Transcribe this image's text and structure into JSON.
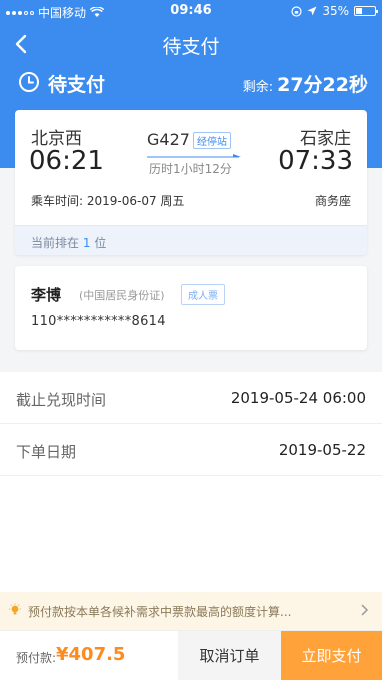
{
  "status_bar": {
    "carrier": "中国移动",
    "time": "09:46",
    "battery": "35%",
    "battery_level": 0.35
  },
  "nav": {
    "title": "待支付"
  },
  "order_status": {
    "label": "待支付",
    "remaining_label": "剩余:",
    "remaining_value": "27分22秒"
  },
  "trip": {
    "from_station": "北京西",
    "from_time": "06:21",
    "to_station": "石家庄",
    "to_time": "07:33",
    "train_no": "G427",
    "via_label": "经停站",
    "duration": "历时1小时12分",
    "depart_text": "乘车时间: 2019-06-07 周五",
    "seat_class": "商务座",
    "queue_prefix": "当前排在",
    "queue_position": "1",
    "queue_suffix": "位"
  },
  "passenger": {
    "name": "李博",
    "id_type": "(中国居民身份证)",
    "ticket_type": "成人票",
    "id_number": "110***********8614"
  },
  "info": {
    "deadline_label": "截止兑现时间",
    "deadline_value": "2019-05-24 06:00",
    "order_date_label": "下单日期",
    "order_date_value": "2019-05-22"
  },
  "notice": {
    "text": "预付款按本单各候补需求中票款最高的额度计算..."
  },
  "bottom": {
    "prepay_label": "预付款:",
    "prepay_value": "¥407.5",
    "cancel_label": "取消订单",
    "pay_label": "立即支付"
  },
  "colors": {
    "primary": "#3c8cf0",
    "accent_orange": "#ffa23a",
    "price_orange": "#ff8a1d",
    "notice_bg": "#fdf5e6"
  }
}
